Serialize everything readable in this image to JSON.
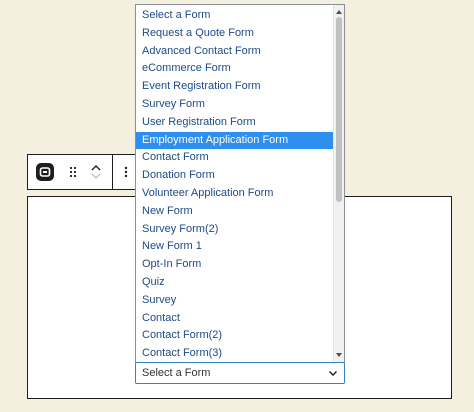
{
  "form_select": {
    "selected_label": "Select a Form",
    "highlighted_index": 7,
    "options": [
      "Select a Form",
      "Request a Quote Form",
      "Advanced Contact Form",
      "eCommerce Form",
      "Event Registration Form",
      "Survey Form",
      "User Registration Form",
      "Employment Application Form",
      "Contact Form",
      "Donation Form",
      "Volunteer Application Form",
      "New Form",
      "Survey Form(2)",
      "New Form 1",
      "Opt-In Form",
      "Quiz",
      "Survey",
      "Contact",
      "Contact Form(2)",
      "Contact Form(3)"
    ]
  },
  "toolbar": {
    "logo_icon": "wpforms-logo-icon",
    "drag_icon": "drag-handle-icon",
    "move_up_icon": "chevron-up-icon",
    "move_down_icon": "chevron-down-icon",
    "more_icon": "more-vertical-icon"
  },
  "colors": {
    "page_bg": "#f5efe0",
    "highlight": "#2f8ff0",
    "option_text": "#1e4a8a",
    "focus_border": "#3582c4"
  }
}
